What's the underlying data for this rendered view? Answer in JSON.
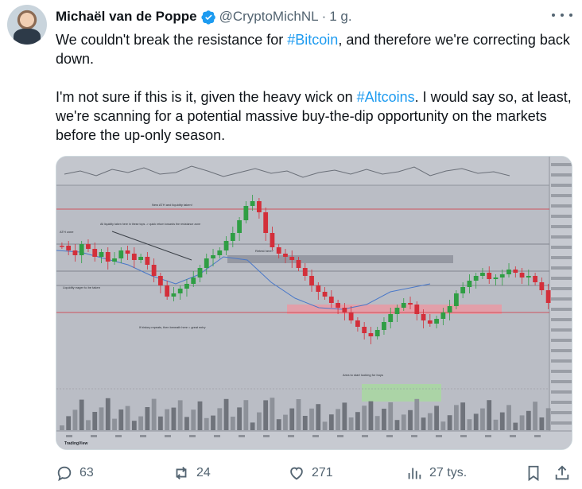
{
  "tweet": {
    "author_name": "Michaël van de Poppe",
    "handle": "@CryptoMichNL",
    "separator": "·",
    "time": "1 g.",
    "verified_color": "#1d9bf0",
    "paragraph1_pre": "We couldn't break the resistance for ",
    "paragraph1_tag": "#Bitcoin",
    "paragraph1_post": ", and therefore we're correcting back down.",
    "paragraph2_pre": "I'm not sure if this is it, given the heavy wick on ",
    "paragraph2_tag": "#Altcoins",
    "paragraph2_post": ". I would say so, at least, we're scanning for a potential massive buy-the-dip opportunity on the markets before the up-only season."
  },
  "chart_image": {
    "annotations": {
      "new_ath": "New ATH and liquidity taken!",
      "liquidity_taken": "All liquidity taken here in these tops -> quick return towards the resistance zone",
      "ath_label": "ATH zone",
      "retest": "Retest here?",
      "liquidity_eager": "Liquidity eager to be taken",
      "history": "If history repeats, then beneath here = great entry",
      "buy_area": "Area to start looking for buys"
    },
    "watermark": "TradingView",
    "colors": {
      "up": "#2f9e44",
      "down": "#d32f3a",
      "zone_red": "#e99aa3",
      "zone_green": "#a8d8a0",
      "zone_gray": "#8e929b"
    }
  },
  "actions": {
    "replies": "63",
    "reposts": "24",
    "likes": "271",
    "views": "27 tys."
  }
}
